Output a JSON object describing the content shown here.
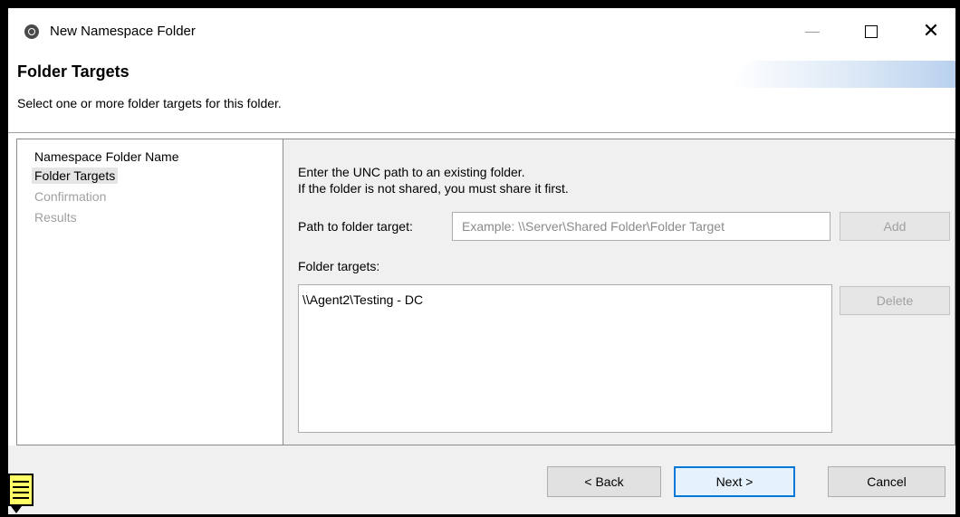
{
  "window": {
    "title": "New Namespace Folder",
    "icon": "app-icon"
  },
  "header": {
    "title": "Folder Targets",
    "description": "Select one or more folder targets for this folder."
  },
  "nav": {
    "items": [
      {
        "label": "Namespace Folder Name",
        "state": "normal"
      },
      {
        "label": "Folder Targets",
        "state": "current"
      },
      {
        "label": "Confirmation",
        "state": "disabled"
      },
      {
        "label": "Results",
        "state": "disabled"
      }
    ]
  },
  "content": {
    "instruction_line1": "Enter the UNC path to an existing folder.",
    "instruction_line2": "If the folder is not shared, you must share it first.",
    "path_label": "Path to folder target:",
    "path_placeholder": "Example: \\\\Server\\Shared Folder\\Folder Target",
    "path_value": "",
    "add_label": "Add",
    "targets_label": "Folder targets:",
    "targets": [
      "\\\\Agent2\\Testing - DC"
    ],
    "delete_label": "Delete"
  },
  "footer": {
    "back_label": "< Back",
    "next_label": "Next >",
    "cancel_label": "Cancel"
  },
  "colors": {
    "focus_border": "#0078d7",
    "content_bg": "#f0f0f0",
    "note_yellow": "#ffff66"
  }
}
